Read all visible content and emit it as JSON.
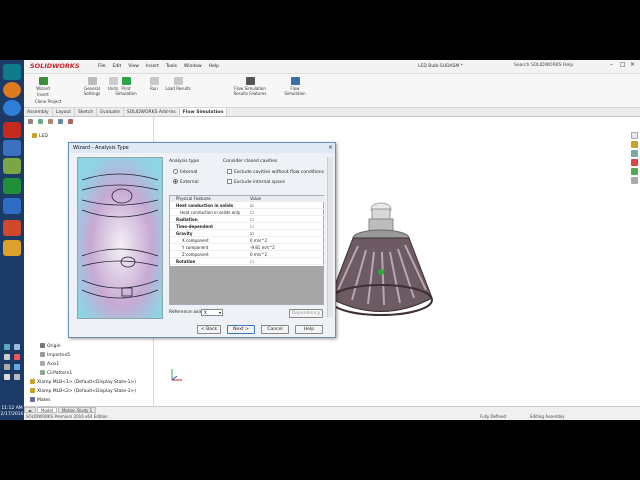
{
  "app": {
    "logo": "SOLIDWORKS",
    "document_title": "LED Bulb-SUDASM *",
    "search_placeholder": "Search SOLIDWORKS Help",
    "menu": [
      "File",
      "Edit",
      "View",
      "Insert",
      "Tools",
      "Window",
      "Help"
    ]
  },
  "ribbon": {
    "buttons": [
      {
        "label": "Wizard",
        "icon": "wizard-icon"
      },
      {
        "label": "Insert",
        "icon": "insert-icon"
      },
      {
        "label": "Clone Project",
        "icon": "clone-icon"
      },
      {
        "label": "General Settings",
        "icon": "settings-icon"
      },
      {
        "label": "Units",
        "icon": "units-icon"
      },
      {
        "label": "Print Simulation",
        "icon": "print-icon"
      },
      {
        "label": "Run",
        "icon": "run-icon"
      },
      {
        "label": "Load Results",
        "icon": "load-icon"
      },
      {
        "label": "Flow Simulation Results Features",
        "icon": "results-features-icon"
      },
      {
        "label": "Flow Simulation",
        "icon": "flow-sim-icon"
      }
    ]
  },
  "tabs": [
    "Assembly",
    "Layout",
    "Sketch",
    "Evaluate",
    "SOLIDWORKS Add-Ins",
    "Flow Simulation"
  ],
  "active_tab": "Flow Simulation",
  "tree": {
    "root": "LED",
    "items": [
      "Origin",
      "Imported1",
      "Axis1",
      "CirPattern1",
      "Xlamp MLB<1> (Default<Display State-1>)",
      "Xlamp MLB<2> (Default<Display State-1>)",
      "Mates"
    ]
  },
  "taskbar": {
    "time": "11:12 AM",
    "date": "2/17/2016"
  },
  "status": {
    "edition": "SOLIDWORKS Premium 2016 x64 Edition",
    "fully_defined": "Fully Defined",
    "editing": "Editing Assembly",
    "model_tab": "Model",
    "motion_tab": "Motion Study 1"
  },
  "dialog": {
    "title": "Wizard - Analysis Type",
    "analysis_type_label": "Analysis type",
    "internal_label": "Internal",
    "external_label": "External",
    "closed_cavities_label": "Consider closed cavities",
    "exclude_cavities_label": "Exclude cavities without flow conditions",
    "exclude_internal_label": "Exclude internal space",
    "physical_features_header": "Physical Features",
    "value_header": "Value",
    "features": [
      {
        "name": "Heat conduction in solids",
        "value": "checked",
        "bold": true
      },
      {
        "name": "Heat conduction in solids only",
        "value": "unchecked",
        "bold": false
      },
      {
        "name": "Radiation",
        "value": "unchecked",
        "bold": true
      },
      {
        "name": "Time-dependent",
        "value": "unchecked",
        "bold": true
      },
      {
        "name": "Gravity",
        "value": "checked",
        "bold": true
      },
      {
        "name": "X component",
        "value": "0 m/s^2",
        "bold": false
      },
      {
        "name": "Y component",
        "value": "-9.81 m/s^2",
        "bold": false
      },
      {
        "name": "Z component",
        "value": "0 m/s^2",
        "bold": false
      },
      {
        "name": "Rotation",
        "value": "unchecked",
        "bold": true
      }
    ],
    "reference_axis_label": "Reference axis:",
    "reference_axis_value": "X",
    "dependency_button": "Dependency",
    "back_button": "< Back",
    "next_button": "Next >",
    "cancel_button": "Cancel",
    "help_button": "Help"
  }
}
